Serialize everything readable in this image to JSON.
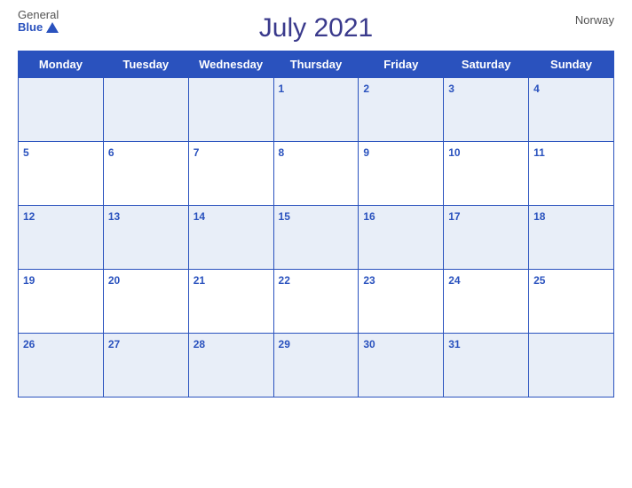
{
  "logo": {
    "general": "General",
    "blue": "Blue"
  },
  "header": {
    "title": "July 2021",
    "country": "Norway"
  },
  "weekdays": [
    "Monday",
    "Tuesday",
    "Wednesday",
    "Thursday",
    "Friday",
    "Saturday",
    "Sunday"
  ],
  "weeks": [
    [
      null,
      null,
      null,
      1,
      2,
      3,
      4
    ],
    [
      5,
      6,
      7,
      8,
      9,
      10,
      11
    ],
    [
      12,
      13,
      14,
      15,
      16,
      17,
      18
    ],
    [
      19,
      20,
      21,
      22,
      23,
      24,
      25
    ],
    [
      26,
      27,
      28,
      29,
      30,
      31,
      null
    ]
  ],
  "colors": {
    "header_bg": "#2a52be",
    "row_odd_bg": "#e8eef8",
    "row_even_bg": "#ffffff",
    "day_number_color": "#2a52be",
    "title_color": "#3a3a8c"
  }
}
